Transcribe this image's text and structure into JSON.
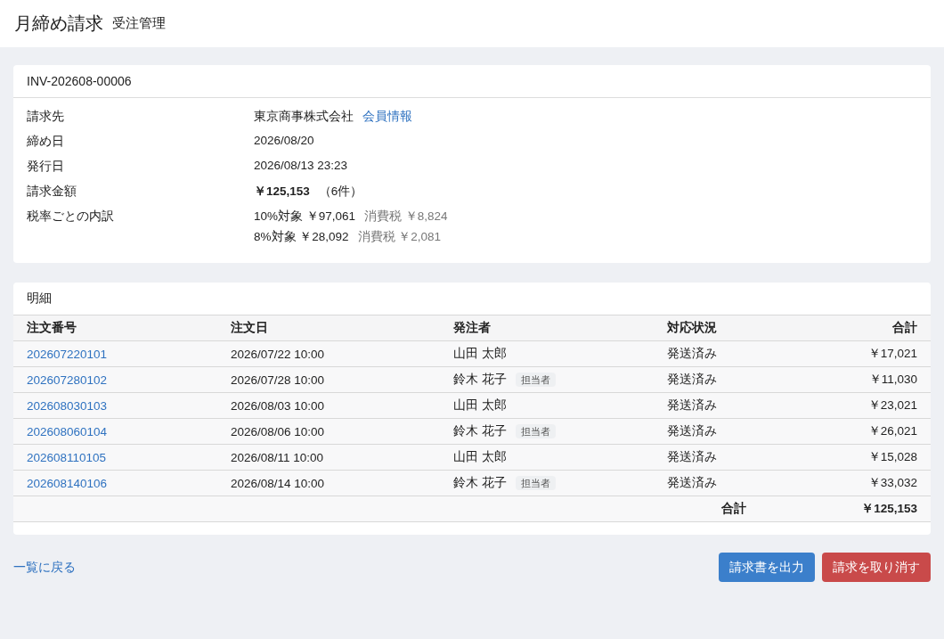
{
  "header": {
    "title": "月締め請求",
    "subtitle": "受注管理"
  },
  "invoice": {
    "number": "INV-202608-00006",
    "fields": [
      {
        "kind": "link",
        "label": "請求先",
        "value": "東京商事株式会社",
        "link": "会員情報"
      },
      {
        "kind": "text",
        "label": "締め日",
        "value": "2026/08/20"
      },
      {
        "kind": "text",
        "label": "発行日",
        "value": "2026/08/13 23:23"
      },
      {
        "kind": "text",
        "label": "請求金額",
        "value": "**￥125,153**（6件）"
      },
      {
        "kind": "breakdown",
        "label": "税率ごとの内訳",
        "lines": [
          {
            "base": "10%対象 ￥97,061",
            "tax": "消費税 ￥8,824"
          },
          {
            "base": "8%対象 ￥28,092",
            "tax": "消費税 ￥2,081"
          }
        ]
      }
    ]
  },
  "details": {
    "title": "明細",
    "columns": [
      "注文番号",
      "注文日",
      "発注者",
      "対応状況",
      "合計"
    ],
    "rows": [
      {
        "order_no": "202607220101",
        "date": "2026/07/22 10:00",
        "orderer": "山田 太郎",
        "status": "発送済み",
        "total": "￥17,021"
      },
      {
        "order_no": "202607280102",
        "date": "2026/07/28 10:00",
        "orderer": "鈴木 花子",
        "tag": "担当者",
        "status": "発送済み",
        "total": "￥11,030"
      },
      {
        "order_no": "202608030103",
        "date": "2026/08/03 10:00",
        "orderer": "山田 太郎",
        "status": "発送済み",
        "total": "￥23,021"
      },
      {
        "order_no": "202608060104",
        "date": "2026/08/06 10:00",
        "orderer": "鈴木 花子",
        "tag": "担当者",
        "status": "発送済み",
        "total": "￥26,021"
      },
      {
        "order_no": "202608110105",
        "date": "2026/08/11 10:00",
        "orderer": "山田 太郎",
        "status": "発送済み",
        "total": "￥15,028"
      },
      {
        "order_no": "202608140106",
        "date": "2026/08/14 10:00",
        "orderer": "鈴木 花子",
        "tag": "担当者",
        "status": "発送済み",
        "total": "￥33,032"
      }
    ],
    "footer": {
      "label": "合計",
      "total": "￥125,153"
    }
  },
  "actions": {
    "back_link": "一覧に戻る",
    "buttons": [
      {
        "kind": "primary",
        "label": "請求書を出力"
      },
      {
        "kind": "danger",
        "label": "請求を取り消す"
      }
    ]
  }
}
